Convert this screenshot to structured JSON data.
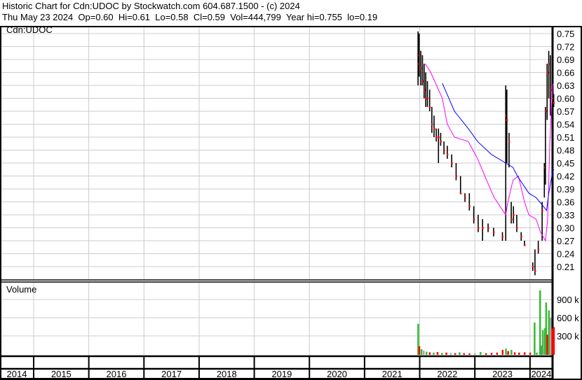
{
  "header": {
    "title": "Historic Chart for Cdn:UDOC by Stockwatch.com 604.687.1500 - (c) 2024",
    "quote_line": "Thu May 23 2024  Op=0.60  Hi=0.61  Lo=0.58  Cl=0.59  Vol=444,799  Year hi=0.755  lo=0.19"
  },
  "chart_data": {
    "type": "ohlc",
    "symbol_label": "Cdn:UDOC",
    "volume_label": "Volume",
    "x_years": [
      "2014",
      "2015",
      "2016",
      "2017",
      "2018",
      "2019",
      "2020",
      "2021",
      "2022",
      "2023",
      "2024"
    ],
    "price_ticks": [
      "0.75",
      "0.72",
      "0.69",
      "0.66",
      "0.63",
      "0.60",
      "0.57",
      "0.54",
      "0.51",
      "0.48",
      "0.45",
      "0.42",
      "0.39",
      "0.36",
      "0.33",
      "0.30",
      "0.27",
      "0.24",
      "0.21"
    ],
    "price_range": [
      0.19,
      0.765
    ],
    "volume_ticks": [
      "900 k",
      "600 k",
      "300 k"
    ],
    "volume_range": [
      0,
      1150000
    ],
    "colors": {
      "bar": "#000000",
      "close": "#ff0000",
      "ma_short": "#ff00ff",
      "ma_long": "#0000ff",
      "vol_up": "#33bb33",
      "vol_down": "#ff0000",
      "vol_flat": "#aaaaaa",
      "grid": "#cccccc"
    },
    "prices": [
      [
        2021.97,
        0.755,
        0.63,
        0.68
      ],
      [
        2021.99,
        0.75,
        0.65,
        0.7
      ],
      [
        2022.02,
        0.71,
        0.63,
        0.67
      ],
      [
        2022.05,
        0.7,
        0.63,
        0.64
      ],
      [
        2022.08,
        0.68,
        0.6,
        0.62
      ],
      [
        2022.11,
        0.66,
        0.58,
        0.6
      ],
      [
        2022.14,
        0.64,
        0.58,
        0.6
      ],
      [
        2022.18,
        0.62,
        0.57,
        0.58
      ],
      [
        2022.22,
        0.58,
        0.52,
        0.54
      ],
      [
        2022.26,
        0.56,
        0.51,
        0.53
      ],
      [
        2022.3,
        0.53,
        0.5,
        0.51
      ],
      [
        2022.34,
        0.53,
        0.45,
        0.51
      ],
      [
        2022.38,
        0.52,
        0.49,
        0.5
      ],
      [
        2022.44,
        0.5,
        0.47,
        0.48
      ],
      [
        2022.5,
        0.49,
        0.46,
        0.47
      ],
      [
        2022.58,
        0.47,
        0.44,
        0.45
      ],
      [
        2022.66,
        0.45,
        0.41,
        0.42
      ],
      [
        2022.74,
        0.42,
        0.38,
        0.38
      ],
      [
        2022.82,
        0.38,
        0.36,
        0.37
      ],
      [
        2022.9,
        0.38,
        0.34,
        0.35
      ],
      [
        2022.98,
        0.35,
        0.31,
        0.32
      ],
      [
        2023.06,
        0.33,
        0.29,
        0.3
      ],
      [
        2023.14,
        0.32,
        0.27,
        0.3
      ],
      [
        2023.24,
        0.31,
        0.29,
        0.3
      ],
      [
        2023.34,
        0.3,
        0.28,
        0.29
      ],
      [
        2023.5,
        0.29,
        0.27,
        0.28
      ],
      [
        2023.56,
        0.63,
        0.27,
        0.56
      ],
      [
        2023.58,
        0.62,
        0.45,
        0.55
      ],
      [
        2023.62,
        0.52,
        0.44,
        0.5
      ],
      [
        2023.66,
        0.36,
        0.31,
        0.32
      ],
      [
        2023.7,
        0.35,
        0.31,
        0.33
      ],
      [
        2023.76,
        0.33,
        0.29,
        0.3
      ],
      [
        2023.84,
        0.29,
        0.27,
        0.28
      ],
      [
        2023.9,
        0.27,
        0.26,
        0.26
      ],
      [
        2024.05,
        0.22,
        0.2,
        0.21
      ],
      [
        2024.09,
        0.25,
        0.19,
        0.2
      ],
      [
        2024.15,
        0.27,
        0.24,
        0.25
      ],
      [
        2024.22,
        0.36,
        0.27,
        0.34
      ],
      [
        2024.26,
        0.45,
        0.37,
        0.44
      ],
      [
        2024.28,
        0.58,
        0.4,
        0.57
      ],
      [
        2024.31,
        0.68,
        0.55,
        0.66
      ],
      [
        2024.34,
        0.71,
        0.6,
        0.68
      ],
      [
        2024.37,
        0.7,
        0.56,
        0.62
      ],
      [
        2024.4,
        0.63,
        0.52,
        0.6
      ],
      [
        2024.43,
        0.61,
        0.58,
        0.59
      ]
    ],
    "ma_short": [
      [
        2022.1,
        0.68
      ],
      [
        2022.2,
        0.66
      ],
      [
        2022.41,
        0.6
      ],
      [
        2022.5,
        0.54
      ],
      [
        2022.63,
        0.51
      ],
      [
        2022.88,
        0.5
      ],
      [
        2023.05,
        0.46
      ],
      [
        2023.18,
        0.42
      ],
      [
        2023.35,
        0.37
      ],
      [
        2023.56,
        0.33
      ],
      [
        2023.6,
        0.36
      ],
      [
        2023.69,
        0.41
      ],
      [
        2023.79,
        0.42
      ],
      [
        2023.9,
        0.36
      ],
      [
        2023.98,
        0.33
      ],
      [
        2024.11,
        0.32
      ],
      [
        2024.19,
        0.29
      ],
      [
        2024.28,
        0.27
      ],
      [
        2024.32,
        0.32
      ],
      [
        2024.36,
        0.5
      ],
      [
        2024.41,
        0.63
      ],
      [
        2024.43,
        0.635
      ]
    ],
    "ma_long": [
      [
        2022.41,
        0.635
      ],
      [
        2022.63,
        0.57
      ],
      [
        2022.88,
        0.53
      ],
      [
        2023.05,
        0.5
      ],
      [
        2023.3,
        0.47
      ],
      [
        2023.56,
        0.45
      ],
      [
        2023.69,
        0.44
      ],
      [
        2023.77,
        0.42
      ],
      [
        2023.98,
        0.38
      ],
      [
        2024.11,
        0.37
      ],
      [
        2024.24,
        0.35
      ],
      [
        2024.3,
        0.34
      ],
      [
        2024.34,
        0.38
      ],
      [
        2024.41,
        0.43
      ],
      [
        2024.43,
        0.435
      ]
    ],
    "volume": [
      [
        2021.97,
        500000,
        "up"
      ],
      [
        2021.99,
        130000,
        "down"
      ],
      [
        2022.03,
        80000,
        "up"
      ],
      [
        2022.07,
        60000,
        "flat"
      ],
      [
        2022.12,
        40000,
        "up"
      ],
      [
        2022.18,
        30000,
        "down"
      ],
      [
        2022.25,
        25000,
        "up"
      ],
      [
        2022.32,
        35000,
        "down"
      ],
      [
        2022.4,
        20000,
        "up"
      ],
      [
        2022.48,
        25000,
        "down"
      ],
      [
        2022.56,
        20000,
        "flat"
      ],
      [
        2022.64,
        15000,
        "down"
      ],
      [
        2022.72,
        30000,
        "up"
      ],
      [
        2022.8,
        15000,
        "down"
      ],
      [
        2022.9,
        12000,
        "down"
      ],
      [
        2023.0,
        15000,
        "flat"
      ],
      [
        2023.1,
        35000,
        "up"
      ],
      [
        2023.2,
        15000,
        "down"
      ],
      [
        2023.3,
        20000,
        "down"
      ],
      [
        2023.4,
        25000,
        "down"
      ],
      [
        2023.5,
        70000,
        "down"
      ],
      [
        2023.56,
        90000,
        "up"
      ],
      [
        2023.6,
        50000,
        "down"
      ],
      [
        2023.66,
        70000,
        "up"
      ],
      [
        2023.72,
        30000,
        "down"
      ],
      [
        2023.8,
        25000,
        "down"
      ],
      [
        2023.9,
        30000,
        "down"
      ],
      [
        2024.0,
        25000,
        "down"
      ],
      [
        2024.08,
        520000,
        "up"
      ],
      [
        2024.12,
        25000,
        "up"
      ],
      [
        2024.18,
        1050000,
        "up"
      ],
      [
        2024.2,
        140000,
        "up"
      ],
      [
        2024.23,
        400000,
        "up"
      ],
      [
        2024.25,
        350000,
        "flat"
      ],
      [
        2024.27,
        430000,
        "up"
      ],
      [
        2024.29,
        850000,
        "up"
      ],
      [
        2024.31,
        320000,
        "down"
      ],
      [
        2024.34,
        720000,
        "up"
      ],
      [
        2024.37,
        600000,
        "flat"
      ],
      [
        2024.4,
        420000,
        "down"
      ],
      [
        2024.43,
        444799,
        "down"
      ]
    ]
  }
}
